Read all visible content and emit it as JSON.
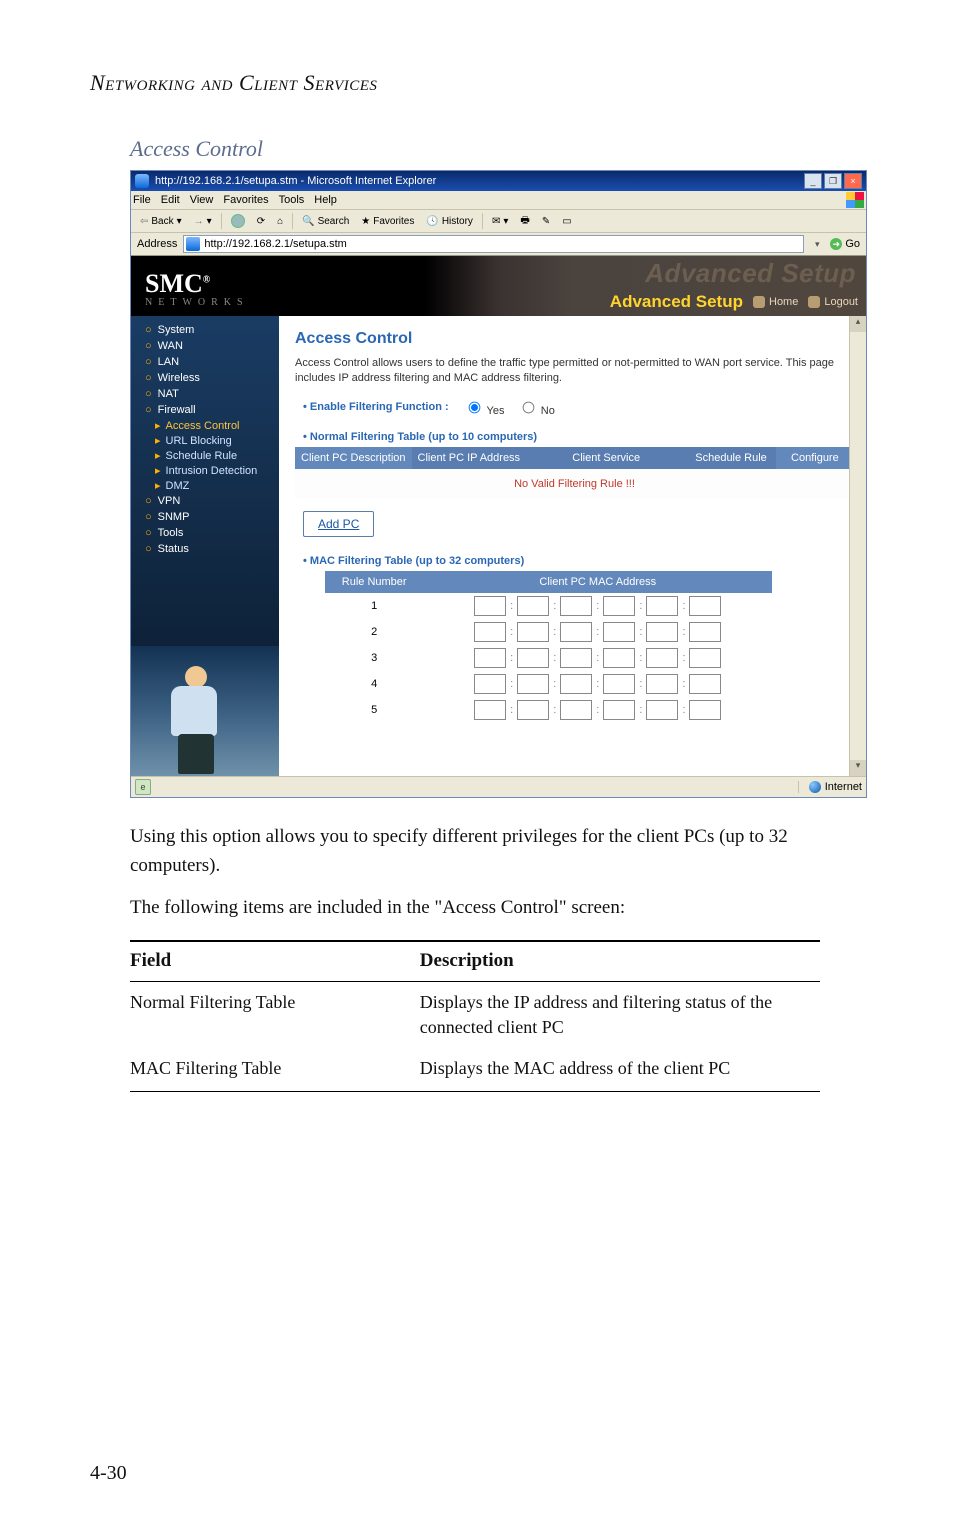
{
  "doc": {
    "running_head": "Networking and Client Services",
    "section_title": "Access Control",
    "intro_para": "Using this option allows you to specify different privileges for the client PCs (up to 32 computers).",
    "lead_in": "The following items are included in the \"Access Control\" screen:",
    "table": {
      "head_field": "Field",
      "head_desc": "Description",
      "rows": [
        {
          "field": "Normal Filtering Table",
          "desc": "Displays the IP address and filtering status of the connected client PC"
        },
        {
          "field": "MAC Filtering Table",
          "desc": "Displays the MAC address of the client PC"
        }
      ]
    },
    "page_number": "4-30"
  },
  "browser": {
    "title": "http://192.168.2.1/setupa.stm - Microsoft Internet Explorer",
    "menus": [
      "File",
      "Edit",
      "View",
      "Favorites",
      "Tools",
      "Help"
    ],
    "toolbar": {
      "back": "Back",
      "search": "Search",
      "favorites": "Favorites",
      "history": "History"
    },
    "address_label": "Address",
    "address_value": "http://192.168.2.1/setupa.stm",
    "go_label": "Go",
    "status_left_icon": "e",
    "status_left": "",
    "status_right": "Internet"
  },
  "site": {
    "brand": "SMC",
    "brand_sub": "Networks",
    "ghost": "Advanced Setup",
    "adv_label": "Advanced Setup",
    "home": "Home",
    "logout": "Logout"
  },
  "nav": {
    "items": [
      {
        "label": "System"
      },
      {
        "label": "WAN"
      },
      {
        "label": "LAN"
      },
      {
        "label": "Wireless"
      },
      {
        "label": "NAT"
      },
      {
        "label": "Firewall",
        "children": [
          {
            "label": "Access Control",
            "sel": true
          },
          {
            "label": "URL Blocking"
          },
          {
            "label": "Schedule Rule"
          },
          {
            "label": "Intrusion Detection"
          },
          {
            "label": "DMZ"
          }
        ]
      },
      {
        "label": "VPN"
      },
      {
        "label": "SNMP"
      },
      {
        "label": "Tools"
      },
      {
        "label": "Status"
      }
    ]
  },
  "panel": {
    "title": "Access Control",
    "desc": "Access Control allows users to define the traffic type permitted or not-permitted to WAN port service. This page includes IP address filtering and MAC address filtering.",
    "enable_label": "Enable Filtering Function :",
    "yes": "Yes",
    "no": "No",
    "normal_title": "Normal Filtering Table (up to 10 computers)",
    "normal_headers": {
      "c1": "Client PC Description",
      "c2": "Client PC IP Address",
      "c3": "Client Service",
      "c4": "Schedule Rule",
      "c5": "Configure"
    },
    "no_valid": "No Valid Filtering Rule !!!",
    "add_pc": "Add PC",
    "mac_title": "MAC Filtering Table (up to 32 computers)",
    "mac_headers": {
      "rule": "Rule Number",
      "mac": "Client PC MAC Address"
    },
    "mac_rows": [
      1,
      2,
      3,
      4,
      5
    ]
  }
}
